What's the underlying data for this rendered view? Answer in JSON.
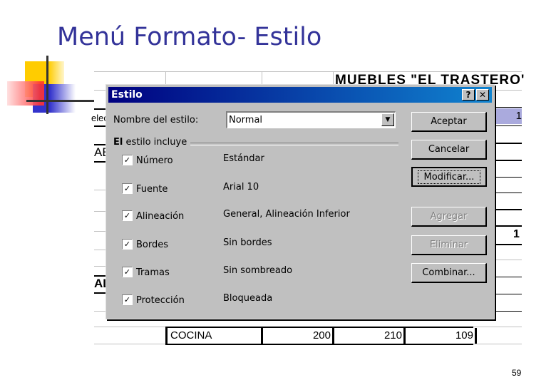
{
  "slide": {
    "title": "Menú Formato- Estilo",
    "page_number": "59"
  },
  "spreadsheet": {
    "title": "MUEBLES \"EL TRASTERO'",
    "left_fragments": [
      "elec",
      "AE",
      "AL"
    ],
    "right_values": [
      "1",
      "1"
    ],
    "rows": [
      {
        "name": "COCINA",
        "values": [
          "200",
          "210",
          "109"
        ]
      }
    ]
  },
  "dialog": {
    "title": "Estilo",
    "help_button": "?",
    "close_button": "✕",
    "style_name_label": "Nombre del estilo:",
    "style_name_value": "Normal",
    "group_label_bold": "El",
    "group_label_rest": " estilo incluye",
    "options": [
      {
        "label": "Número",
        "value": "Estándar",
        "checked": true
      },
      {
        "label": "Fuente",
        "value": "Arial 10",
        "checked": true
      },
      {
        "label": "Alineación",
        "value": "General, Alineación Inferior",
        "checked": true
      },
      {
        "label": "Bordes",
        "value": "Sin bordes",
        "checked": true
      },
      {
        "label": "Tramas",
        "value": "Sin sombreado",
        "checked": true
      },
      {
        "label": "Protección",
        "value": "Bloqueada",
        "checked": true
      }
    ],
    "buttons": {
      "accept": "Aceptar",
      "cancel": "Cancelar",
      "modify": "Modificar...",
      "add": "Agregar",
      "delete": "Eliminar",
      "merge": "Combinar..."
    }
  },
  "colors": {
    "title_color": "#333399",
    "titlebar_start": "#000080",
    "titlebar_end": "#1084d0",
    "dialog_bg": "#c0c0c0",
    "highlight_cell": "#aaaadd"
  }
}
